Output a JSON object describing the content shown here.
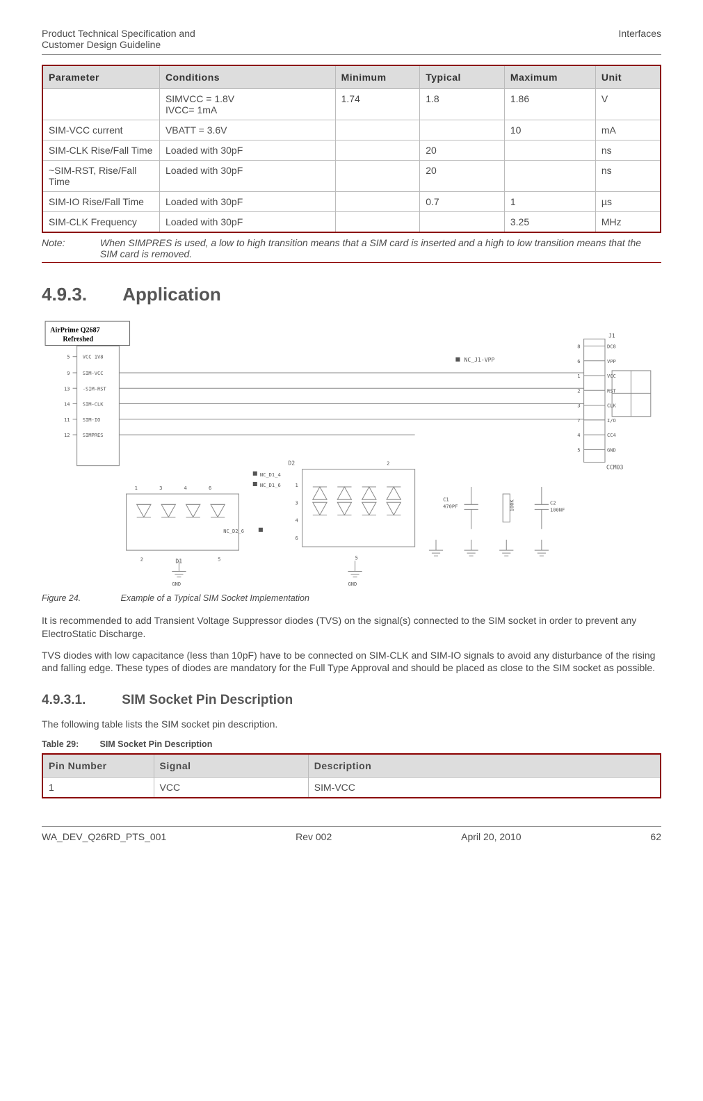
{
  "header": {
    "left_line1": "Product Technical Specification and",
    "left_line2": "Customer Design Guideline",
    "right": "Interfaces"
  },
  "spec_table": {
    "headers": [
      "Parameter",
      "Conditions",
      "Minimum",
      "Typical",
      "Maximum",
      "Unit"
    ],
    "rows": [
      {
        "param": "",
        "cond": "SIMVCC = 1.8V\nIVCC= 1mA",
        "min": "1.74",
        "typ": "1.8",
        "max": "1.86",
        "unit": "V"
      },
      {
        "param": "SIM-VCC current",
        "cond": "VBATT = 3.6V",
        "min": "",
        "typ": "",
        "max": "10",
        "unit": "mA"
      },
      {
        "param": "SIM-CLK Rise/Fall Time",
        "cond": "Loaded with 30pF",
        "min": "",
        "typ": "20",
        "max": "",
        "unit": "ns"
      },
      {
        "param": "~SIM-RST, Rise/Fall Time",
        "cond": "Loaded with 30pF",
        "min": "",
        "typ": "20",
        "max": "",
        "unit": "ns"
      },
      {
        "param": "SIM-IO Rise/Fall Time",
        "cond": "Loaded with 30pF",
        "min": "",
        "typ": "0.7",
        "max": "1",
        "unit": "µs"
      },
      {
        "param": "SIM-CLK Frequency",
        "cond": "Loaded with 30pF",
        "min": "",
        "typ": "",
        "max": "3.25",
        "unit": "MHz"
      }
    ]
  },
  "note": {
    "label": "Note:",
    "text": "When SIMPRES is used, a low to high transition means that a SIM card is inserted and a high to low transition means that the SIM card is removed."
  },
  "section": {
    "num": "4.9.3.",
    "title": "Application"
  },
  "figure": {
    "chip_label_l1": "AirPrime Q2687",
    "chip_label_l2": "Refreshed",
    "left_pins": [
      {
        "n": "5",
        "name": "VCC 1V8"
      },
      {
        "n": "9",
        "name": "SIM-VCC"
      },
      {
        "n": "13",
        "name": "-SIM-RST"
      },
      {
        "n": "14",
        "name": "SIM-CLK"
      },
      {
        "n": "11",
        "name": "SIM-IO"
      },
      {
        "n": "12",
        "name": "SIMPRES"
      }
    ],
    "right_pins": [
      {
        "n": "8",
        "name": "DC8"
      },
      {
        "n": "6",
        "name": "VPP"
      },
      {
        "n": "1",
        "name": "VCC"
      },
      {
        "n": "2",
        "name": "RST"
      },
      {
        "n": "3",
        "name": "CLK"
      },
      {
        "n": "7",
        "name": "I/O"
      },
      {
        "n": "4",
        "name": "CC4"
      },
      {
        "n": "5",
        "name": "GND"
      }
    ],
    "conn_label": "J1",
    "conn_model": "CCM03",
    "nc_vpp": "NC_J1-VPP",
    "d1": "D1",
    "d2": "D2",
    "nc_d14": "NC_D1_4",
    "nc_d16": "NC_D1_6",
    "nc_d26": "NC_D2_6",
    "c1_name": "C1",
    "c1_val": "470PF",
    "r1_name": "100K",
    "c2_name": "C2",
    "c2_val": "100NF",
    "gnd": "GND",
    "d1_pins_top": [
      "1",
      "3",
      "4",
      "6"
    ],
    "d1_pins_bot": [
      "2",
      "5"
    ],
    "d2_pins_side": [
      "1",
      "3",
      "4",
      "6"
    ],
    "d2_pin_bot": "5",
    "d2_pin_top": "2"
  },
  "fig_caption": {
    "num": "Figure 24.",
    "text": "Example of a Typical SIM Socket Implementation"
  },
  "para1": "It is recommended to add Transient Voltage Suppressor diodes (TVS) on the signal(s) connected to the SIM socket in order to prevent any ElectroStatic Discharge.",
  "para2": "TVS diodes with low capacitance (less than 10pF) have to be connected on SIM-CLK and SIM-IO signals to avoid any disturbance of the rising and falling edge. These types of diodes are mandatory for the Full Type Approval and should be placed as close to the SIM socket as possible.",
  "subsection": {
    "num": "4.9.3.1.",
    "title": "SIM Socket Pin Description"
  },
  "para3": "The following table lists the SIM socket pin description.",
  "table29": {
    "num": "Table 29:",
    "title": "SIM Socket Pin Description",
    "headers": [
      "Pin Number",
      "Signal",
      "Description"
    ],
    "rows": [
      {
        "pin": "1",
        "sig": "VCC",
        "desc": "SIM-VCC"
      }
    ]
  },
  "footer": {
    "doc": "WA_DEV_Q26RD_PTS_001",
    "rev": "Rev 002",
    "date": "April 20, 2010",
    "page": "62"
  }
}
